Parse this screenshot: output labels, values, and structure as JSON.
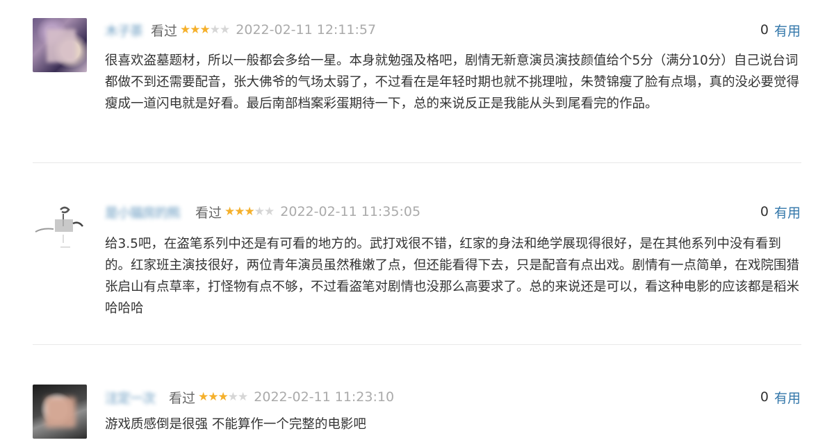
{
  "comments": [
    {
      "username": "木子茶",
      "status": "看过",
      "rating_stars": 3,
      "time": "2022-02-11 12:11:57",
      "vote_count": "0",
      "useful_label": "有用",
      "content": "很喜欢盗墓题材，所以一般都会多给一星。本身就勉强及格吧，剧情无新意演员演技颜值给个5分（满分10分）自己说台词都做不到还需要配音，张大佛爷的气场太弱了，不过看在是年轻时期也就不挑理啦，朱赞锦瘦了脸有点塌，真的没必要觉得瘦成一道闪电就是好看。最后南部档案彩蛋期待一下，总的来说反正是我能从头到尾看完的作品。"
    },
    {
      "username": "是小猫房的熊",
      "status": "看过",
      "rating_stars": 3,
      "time": "2022-02-11 11:35:05",
      "vote_count": "0",
      "useful_label": "有用",
      "content": "给3.5吧，在盗笔系列中还是有可看的地方的。武打戏很不错，红家的身法和绝学展现得很好，是在其他系列中没有看到的。红家班主演技很好，两位青年演员虽然稚嫩了点，但还能看得下去，只是配音有点出戏。剧情有一点简单，在戏院围猎张启山有点草率，打怪物有点不够，不过看盗笔对剧情也没那么高要求了。总的来说还是可以，看这种电影的应该都是稻米哈哈哈"
    },
    {
      "username": "注定一次",
      "status": "看过",
      "rating_stars": 3,
      "time": "2022-02-11 11:23:10",
      "vote_count": "0",
      "useful_label": "有用",
      "content": "游戏质感倒是很强 不能算作一个完整的电影吧"
    }
  ],
  "colors": {
    "link": "#3377aa",
    "star": "#f5b02b",
    "star_empty": "#d6d6d6",
    "muted": "#aaaaaa",
    "text": "#333333",
    "divider": "#e8e8e8"
  },
  "icons": {
    "star_filled": "star-filled-icon",
    "star_empty": "star-empty-icon"
  }
}
